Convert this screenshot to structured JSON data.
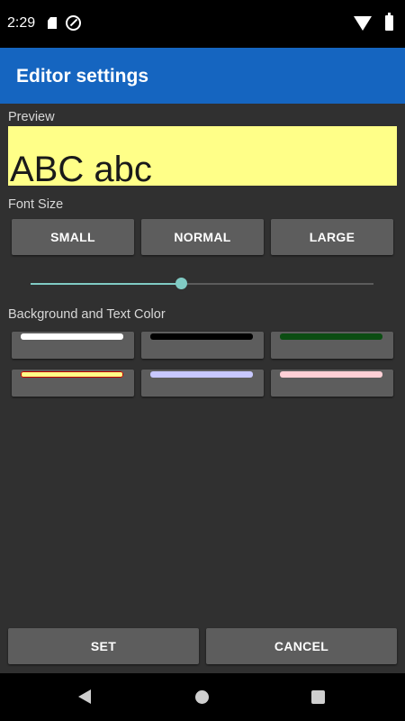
{
  "status_bar": {
    "time": "2:29"
  },
  "app_bar": {
    "title": "Editor settings"
  },
  "preview": {
    "label": "Preview",
    "sample_text": "ABC abc",
    "background_color": "#ffff88",
    "text_color": "#1a1a1a"
  },
  "font_size": {
    "label": "Font Size",
    "buttons": [
      "SMALL",
      "NORMAL",
      "LARGE"
    ],
    "slider_value_fraction": 0.44
  },
  "color_section": {
    "label": "Background and Text Color",
    "swatches": [
      {
        "color": "#ffffff"
      },
      {
        "color": "#000000"
      },
      {
        "color": "#0b4d12"
      },
      {
        "color": "#ffff88",
        "border": "#c00000"
      },
      {
        "color": "#c8c8ff"
      },
      {
        "color": "#ffd0d6"
      }
    ]
  },
  "actions": {
    "set_label": "SET",
    "cancel_label": "CANCEL"
  },
  "accent_color": "#1565c0",
  "slider_color": "#80cbc4"
}
